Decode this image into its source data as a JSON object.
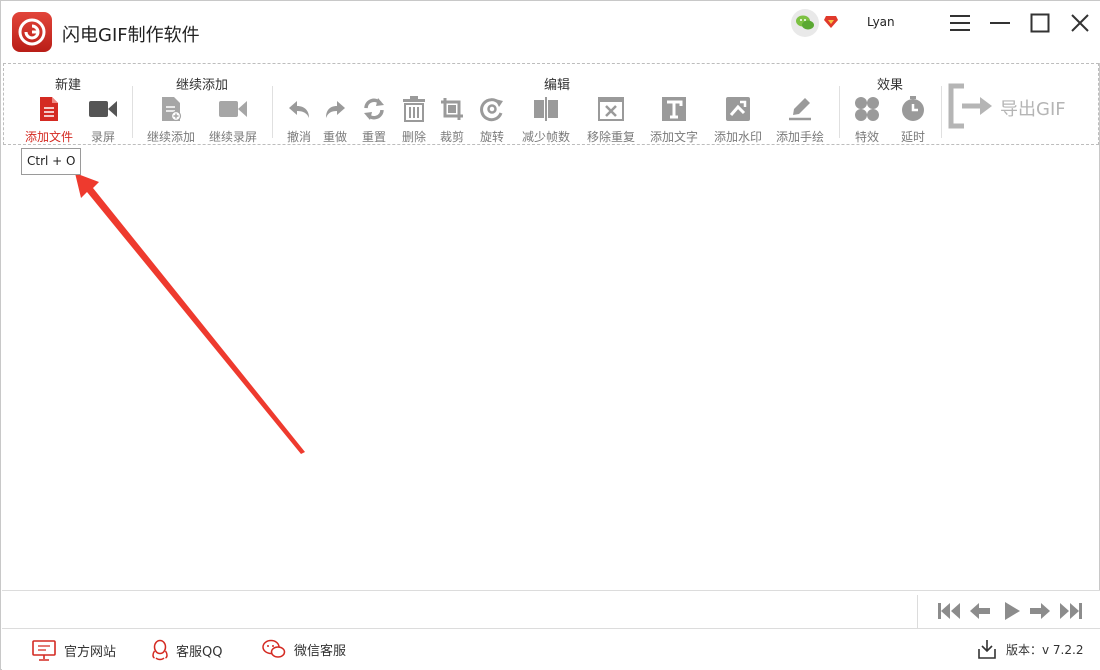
{
  "app": {
    "title": "闪电GIF制作软件"
  },
  "user": {
    "name": "Lyan"
  },
  "toolbar": {
    "groups": {
      "new": "新建",
      "continue": "继续添加",
      "edit": "编辑",
      "effects": "效果"
    },
    "tools": {
      "add_file": "添加文件",
      "record": "录屏",
      "continue_add": "继续添加",
      "continue_record": "继续录屏",
      "undo": "撤消",
      "redo": "重做",
      "reset": "重置",
      "delete": "删除",
      "crop": "裁剪",
      "rotate": "旋转",
      "reduce_frames": "减少帧数",
      "remove_duplicates": "移除重复",
      "add_text": "添加文字",
      "add_watermark": "添加水印",
      "add_handdrawing": "添加手绘",
      "special_effects": "特效",
      "delay": "延时"
    },
    "export_label": "导出GIF"
  },
  "tooltip": {
    "text": "Ctrl + O"
  },
  "statusbar": {
    "website": "官方网站",
    "qq_support": "客服QQ",
    "wechat_support": "微信客服",
    "version": "版本：v 7.2.2"
  },
  "colors": {
    "accent": "#d42a22",
    "icon_gray": "#8c8c8c",
    "disabled": "#b5b5b5",
    "arrow": "#ee3a2e"
  }
}
